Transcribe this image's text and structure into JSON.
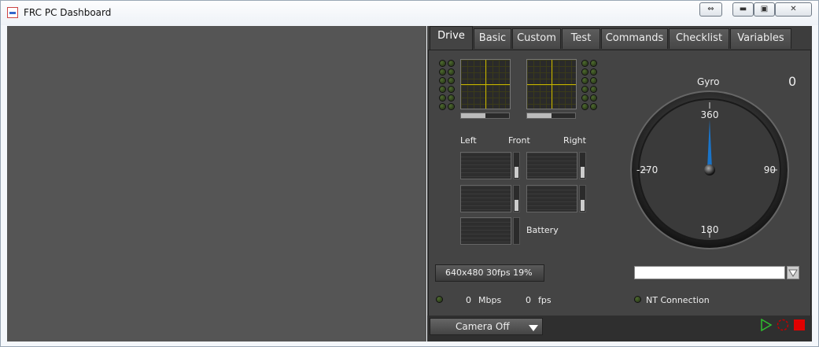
{
  "window": {
    "title": "FRC PC Dashboard"
  },
  "tabs": [
    "Drive",
    "Basic",
    "Custom",
    "Test",
    "Commands",
    "Checklist",
    "Variables"
  ],
  "active_tab": "Drive",
  "drive": {
    "labels": {
      "left": "Left",
      "front": "Front",
      "right": "Right",
      "battery": "Battery"
    },
    "gyro": {
      "title": "Gyro",
      "value": "0",
      "ticks": {
        "top": "360",
        "right": "90",
        "bottom": "180",
        "left": "-270"
      }
    },
    "camera_info": "640x480   30fps   19%",
    "bandwidth": {
      "value": "0",
      "unit": "Mbps"
    },
    "framerate": {
      "value": "0",
      "unit": "fps"
    },
    "nt_connection": "NT Connection",
    "camera_select": "Camera Off",
    "slider_left_level": 0.5,
    "slider_right_level": 0.5
  },
  "colors": {
    "accent": "#c8b400",
    "needle": "#1a74c8",
    "stop": "#e00000",
    "run": "#2fbf2f"
  }
}
